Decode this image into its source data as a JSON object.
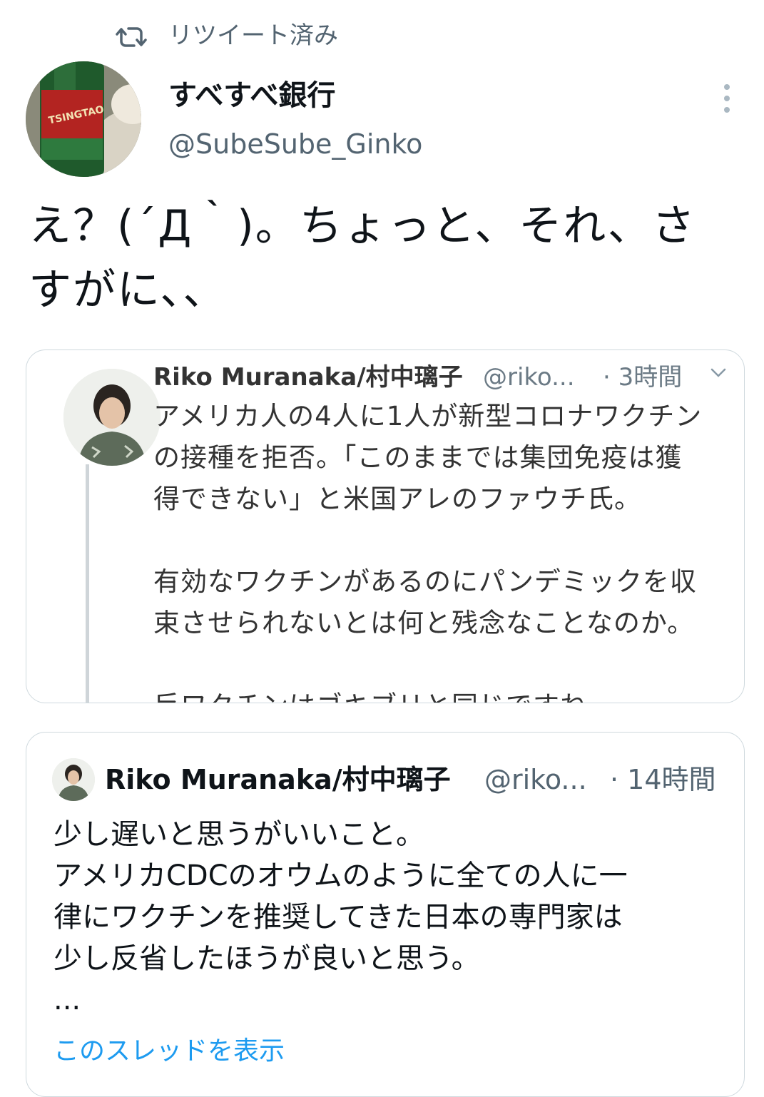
{
  "retweet": {
    "label": "リツイート済み",
    "icon": "retweet-icon"
  },
  "author": {
    "display_name": "すべすべ銀行",
    "handle": "@SubeSube_Ginko",
    "avatar_logo_text": "TSINGTAO"
  },
  "tweet": {
    "text_line1": "え？(´Д｀)。ちょっと、それ、さ",
    "text_line2": "すがに、、"
  },
  "screenshot_card": {
    "name": "Riko Muranaka/村中璃子",
    "handle": "@riko...",
    "time": "· 3時間",
    "lines": [
      "アメリカ人の4人に1人が新型コロナワクチン",
      "の接種を拒否。「このままでは集団免疫は獲",
      "得できない」と米国アレのファウチ氏。",
      "",
      "有効なワクチンがあるのにパンデミックを収",
      "束させられないとは何と残念なことなのか。",
      "",
      "反ワクチンはゴキブリと同じですね。"
    ]
  },
  "quoted_tweet": {
    "name": "Riko Muranaka/村中璃子",
    "handle": "@riko...",
    "time": "· 14時間",
    "lines": [
      "少し遅いと思うがいいこと。",
      "アメリカCDCのオウムのように全ての人に一",
      "律にワクチンを推奨してきた日本の専門家は",
      "少し反省したほうが良いと思う。",
      "..."
    ],
    "show_thread": "このスレッドを表示"
  },
  "colors": {
    "text": "#0f1419",
    "secondary": "#536471",
    "link": "#1d9bf0",
    "border": "#cfd9de"
  }
}
